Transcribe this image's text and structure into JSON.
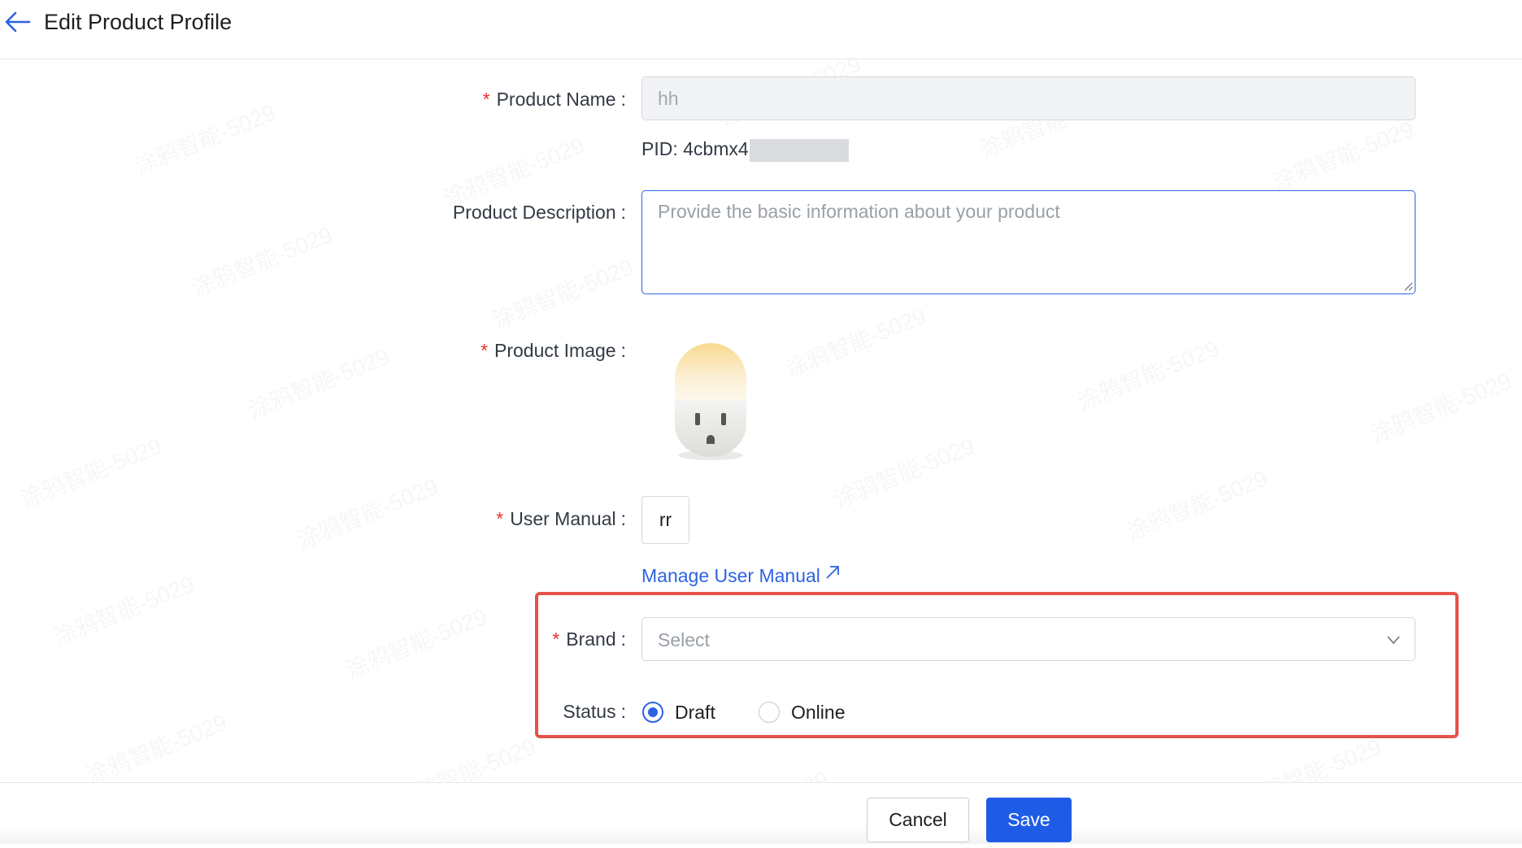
{
  "header": {
    "title": "Edit Product Profile",
    "back_icon": "arrow-left-icon"
  },
  "form": {
    "product_name": {
      "label": "Product Name",
      "required": "*",
      "value": "hh",
      "pid_label": "PID: 4cbmx4"
    },
    "product_description": {
      "label": "Product Description",
      "placeholder": "Provide the basic information about your product"
    },
    "product_image": {
      "label": "Product Image",
      "required": "*",
      "image_icon": "smart-plug-icon"
    },
    "user_manual": {
      "label": "User Manual",
      "required": "*",
      "value": "rr",
      "manage_link": "Manage User Manual",
      "link_icon": "external-link-icon"
    },
    "brand": {
      "label": "Brand",
      "required": "*",
      "placeholder": "Select",
      "dropdown_icon": "chevron-down-icon"
    },
    "status": {
      "label": "Status",
      "options": [
        "Draft",
        "Online"
      ],
      "selected": "Draft"
    },
    "colon": ":"
  },
  "footer": {
    "cancel_label": "Cancel",
    "save_label": "Save"
  },
  "colors": {
    "accent": "#2d63e2",
    "save_button": "#1f5ce6",
    "required": "#e5332f",
    "highlight_border": "#e4524b"
  }
}
